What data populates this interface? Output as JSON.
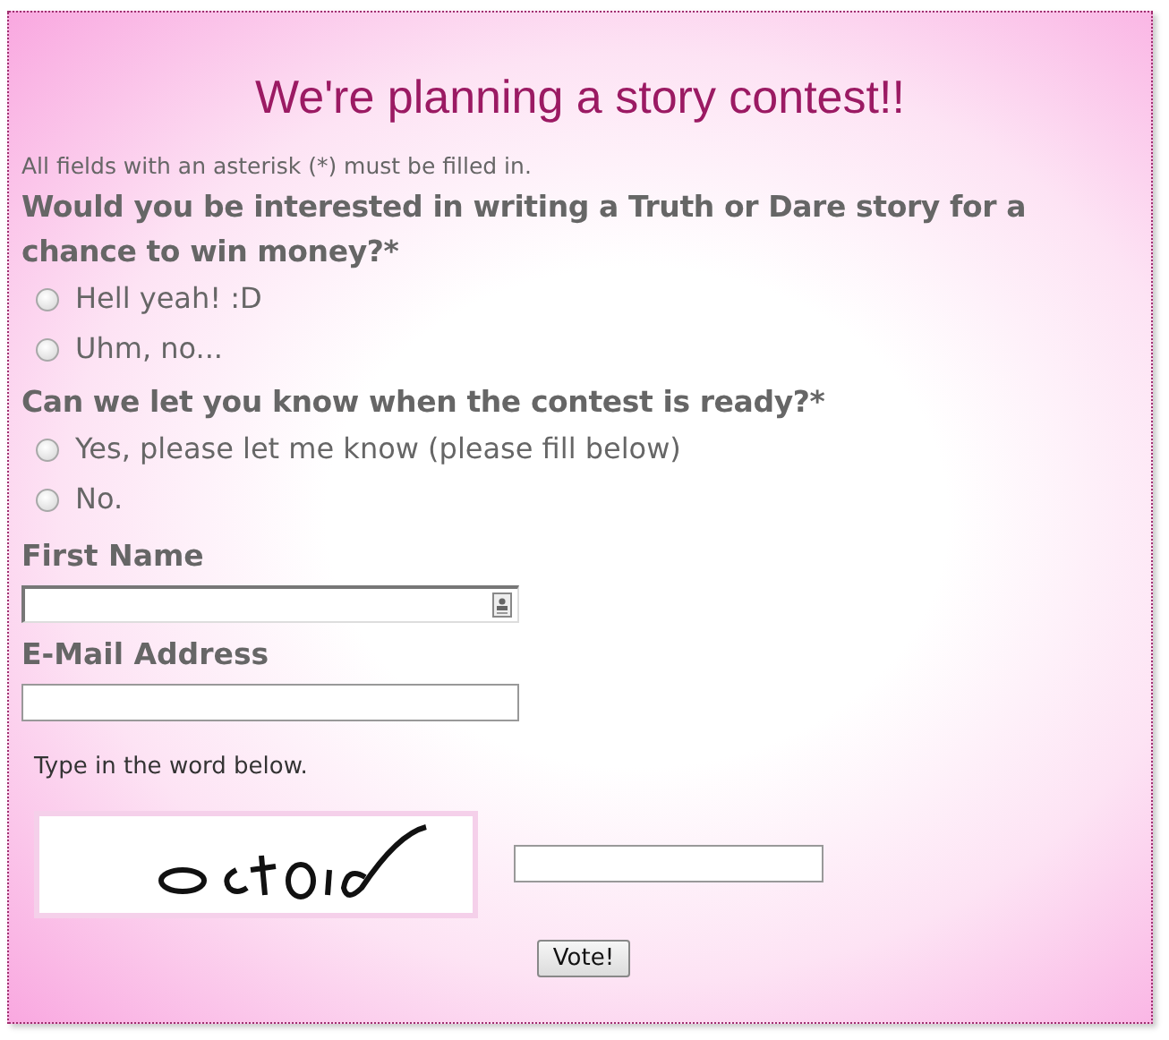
{
  "title": "We're planning a story contest!!",
  "note": "All fields with an asterisk (*) must be filled in.",
  "questions": [
    {
      "label": "Would you be interested in writing a Truth or Dare story for a chance to win money?*",
      "options": [
        {
          "label": "Hell yeah! :D",
          "selected": false
        },
        {
          "label": "Uhm, no...",
          "selected": false
        }
      ]
    },
    {
      "label": "Can we let you know when the contest is ready?*",
      "options": [
        {
          "label": "Yes, please let me know (please fill below)",
          "selected": false
        },
        {
          "label": "No.",
          "selected": false
        }
      ]
    }
  ],
  "fields": [
    {
      "label": "First Name",
      "kind": "contact"
    },
    {
      "label": "E-Mail Address",
      "kind": "plain"
    }
  ],
  "captcha": {
    "prompt": "Type in the word below."
  },
  "submit": "Vote!"
}
